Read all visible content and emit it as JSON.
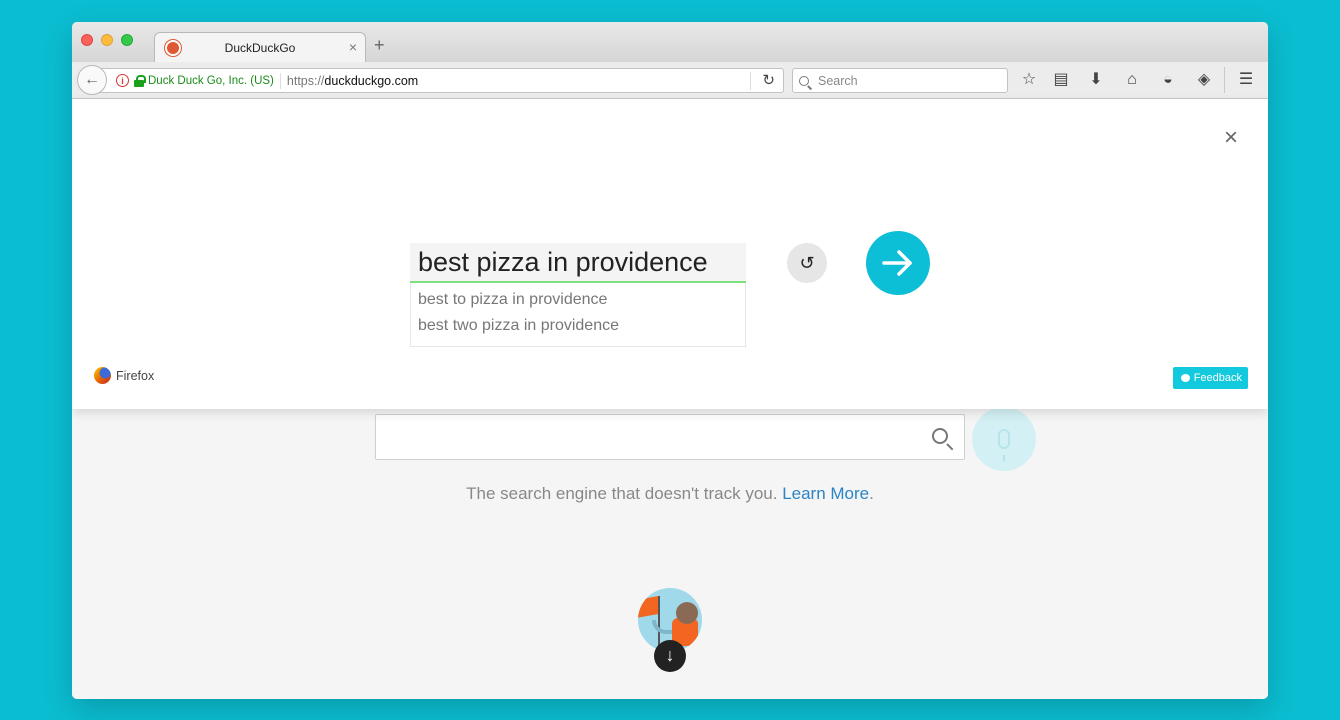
{
  "tab": {
    "title": "DuckDuckGo",
    "close_glyph": "×"
  },
  "newtab": {
    "glyph": "+"
  },
  "navbar": {
    "back_glyph": "←",
    "identity": "Duck Duck Go, Inc. (US)",
    "url_protocol": "https://",
    "url_host": "duckduckgo.com",
    "reload_glyph": "↻",
    "search_placeholder": "Search"
  },
  "toolbar": {
    "icons": [
      "star-icon",
      "reading-list-icon",
      "download-icon",
      "home-icon",
      "pocket-icon",
      "extension-icon",
      "menu-icon"
    ]
  },
  "overlay": {
    "close_glyph": "×",
    "recognized_text": "best pizza in providence",
    "suggestions": [
      "best to pizza in providence",
      "best two pizza in providence"
    ],
    "retry_glyph": "↺",
    "brand": "Firefox",
    "feedback_label": "Feedback",
    "accent": "#0cbfd6"
  },
  "page": {
    "tagline": "The search engine that doesn't track you.",
    "learn_more": "Learn More",
    "tagline_end": ".",
    "down_glyph": "↓"
  },
  "colors": {
    "background": "#0bbdd1",
    "identity": "#1a8d1a",
    "link": "#2a84c6"
  }
}
